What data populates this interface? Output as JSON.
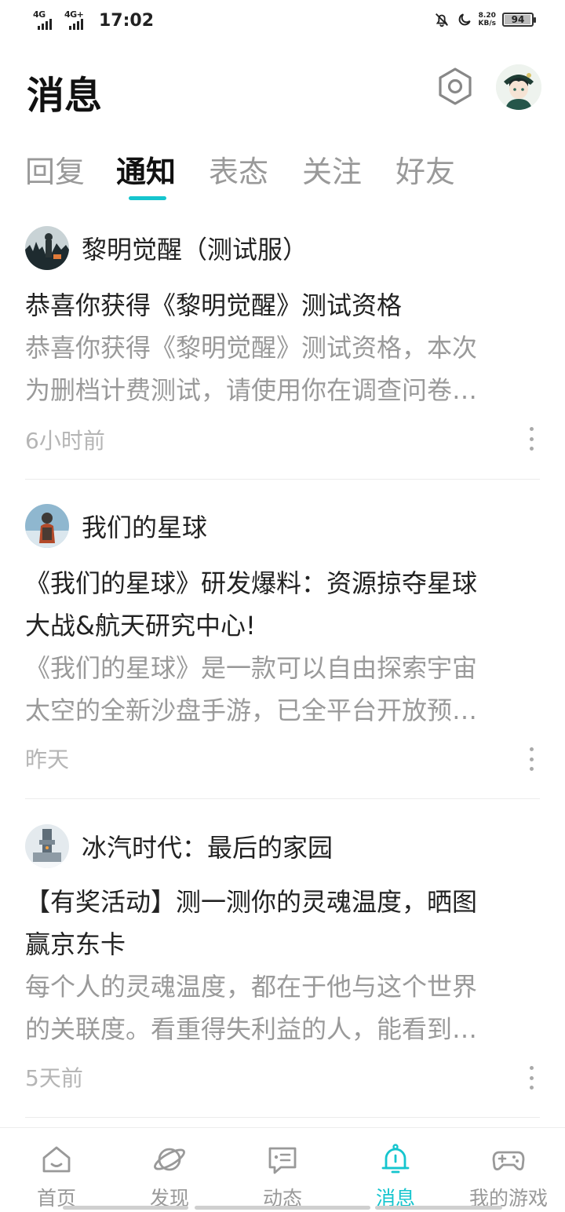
{
  "status_bar": {
    "signal1_label": "4G",
    "signal2_label": "4G+",
    "time": "17:02",
    "net_speed_value": "8.20",
    "net_speed_unit": "KB/s",
    "battery_level": "94",
    "icons": [
      "mute-bell-icon",
      "moon-icon"
    ]
  },
  "header": {
    "title": "消息",
    "settings_icon": "hexagon-settings-icon",
    "avatar_icon": "user-avatar"
  },
  "tabs": [
    {
      "label": "回复",
      "active": false
    },
    {
      "label": "通知",
      "active": true
    },
    {
      "label": "表态",
      "active": false
    },
    {
      "label": "关注",
      "active": false
    },
    {
      "label": "好友",
      "active": false
    }
  ],
  "accent_color": "#15c5ce",
  "messages": [
    {
      "sender": "黎明觉醒（测试服）",
      "title": "恭喜你获得《黎明觉醒》测试资格",
      "body_line1": "恭喜你获得《黎明觉醒》测试资格，本次",
      "body_line2": "为删档计费测试，请使用你在调查问卷…",
      "time": "6小时前"
    },
    {
      "sender": "我们的星球",
      "title_line1": "《我们的星球》研发爆料：资源掠夺星球",
      "title_line2": "大战&航天研究中心!",
      "body_line1": "《我们的星球》是一款可以自由探索宇宙",
      "body_line2": "太空的全新沙盘手游，已全平台开放预…",
      "time": "昨天"
    },
    {
      "sender": "冰汽时代：最后的家园",
      "title_line1": "【有奖活动】测一测你的灵魂温度，晒图",
      "title_line2": "赢京东卡",
      "body_line1": "每个人的灵魂温度，都在于他与这个世界",
      "body_line2": "的关联度。看重得失利益的人，能看到…",
      "time": "5天前"
    }
  ],
  "bottom_nav": [
    {
      "label": "首页",
      "icon": "home-icon",
      "active": false
    },
    {
      "label": "发现",
      "icon": "planet-icon",
      "active": false
    },
    {
      "label": "动态",
      "icon": "chat-card-icon",
      "active": false
    },
    {
      "label": "消息",
      "icon": "bell-icon",
      "active": true
    },
    {
      "label": "我的游戏",
      "icon": "gamepad-icon",
      "active": false
    }
  ]
}
